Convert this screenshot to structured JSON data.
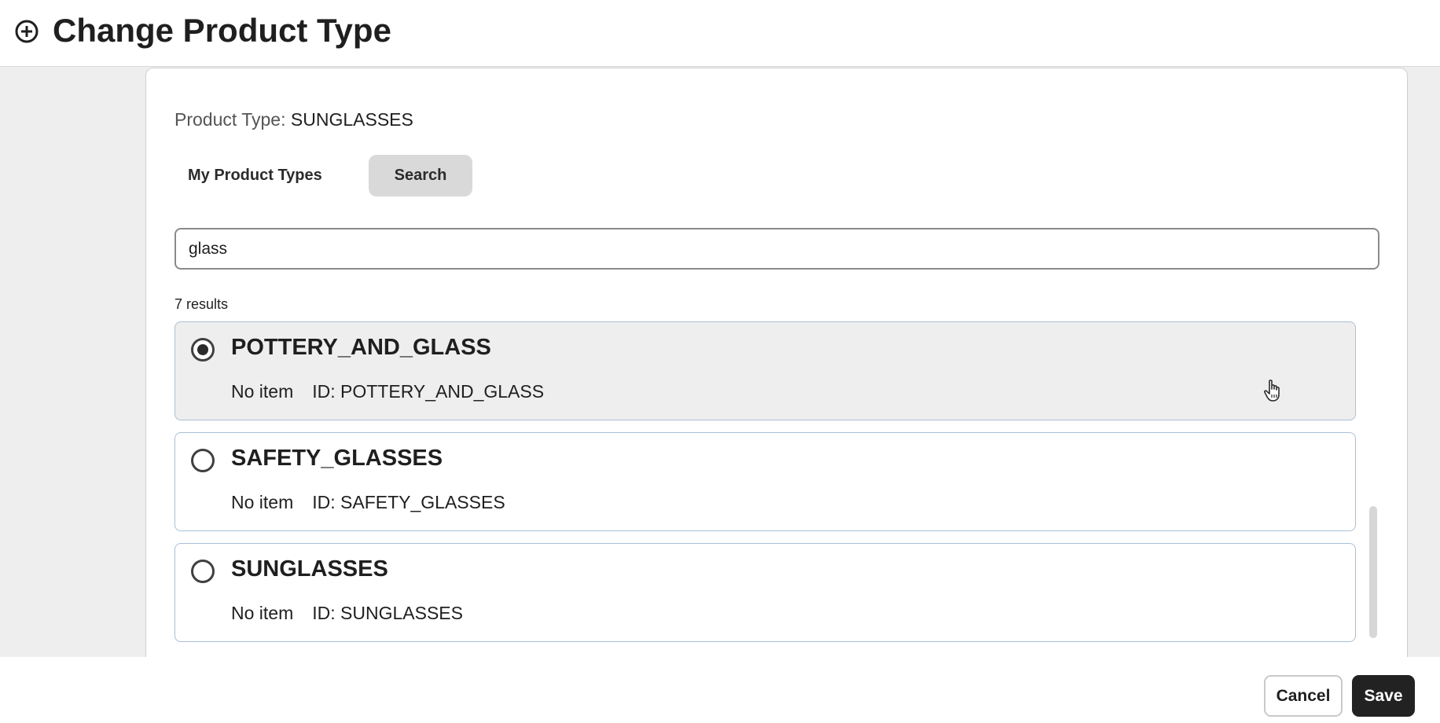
{
  "header": {
    "title": "Change Product Type",
    "icon": "add-circle-icon"
  },
  "current": {
    "label": "Product Type:",
    "value": "SUNGLASSES"
  },
  "tabs": [
    {
      "label": "My Product Types",
      "active": false
    },
    {
      "label": "Search",
      "active": true
    }
  ],
  "search": {
    "value": "glass"
  },
  "results": {
    "count_label": "7 results",
    "items": [
      {
        "name": "POTTERY_AND_GLASS",
        "status": "No item",
        "id_label": "ID: POTTERY_AND_GLASS",
        "selected": true
      },
      {
        "name": "SAFETY_GLASSES",
        "status": "No item",
        "id_label": "ID: SAFETY_GLASSES",
        "selected": false
      },
      {
        "name": "SUNGLASSES",
        "status": "No item",
        "id_label": "ID: SUNGLASSES",
        "selected": false
      }
    ]
  },
  "footer": {
    "cancel_label": "Cancel",
    "save_label": "Save"
  },
  "colors": {
    "primary_button": "#222222",
    "selected_row": "#eeeeee",
    "card_border": "#a9bfd6",
    "active_tab": "#d9d9d9"
  }
}
